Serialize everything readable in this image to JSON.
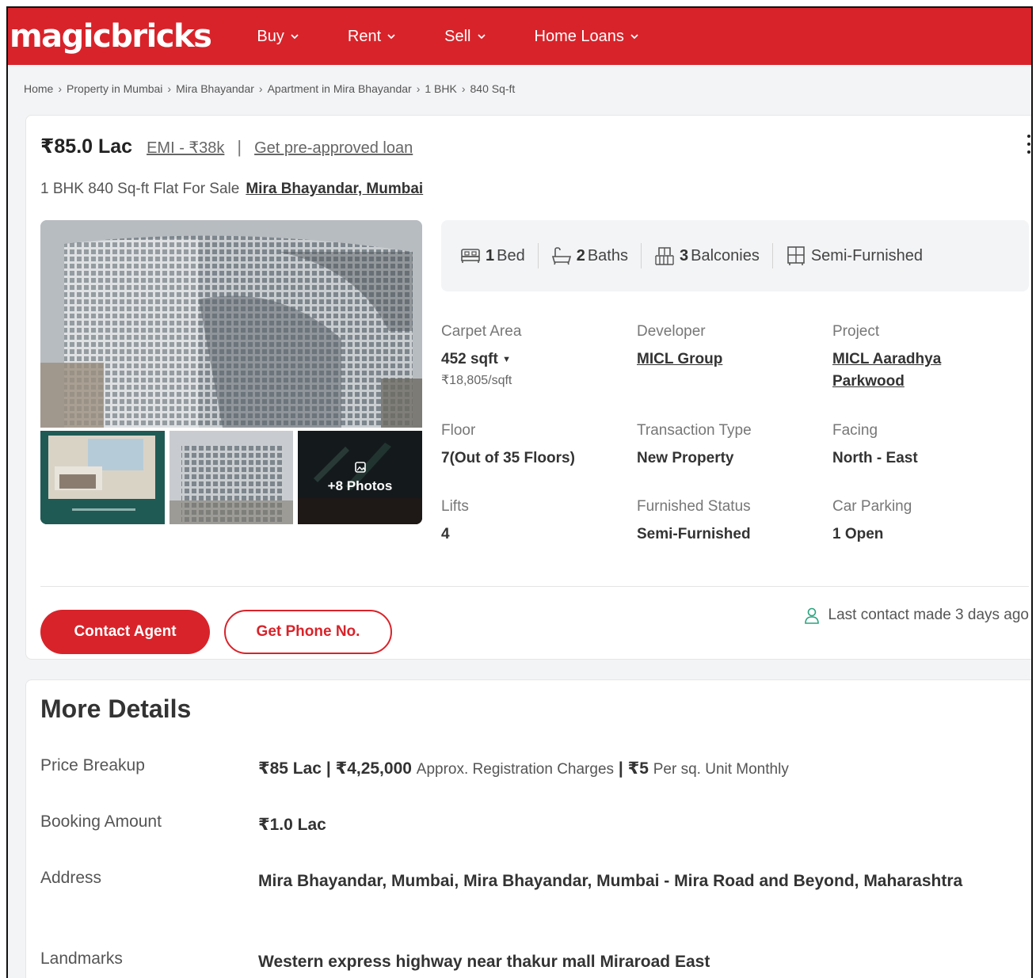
{
  "nav": {
    "logo": "magicbricks",
    "items": [
      {
        "label": "Buy"
      },
      {
        "label": "Rent"
      },
      {
        "label": "Sell"
      },
      {
        "label": "Home Loans"
      }
    ],
    "brand_color": "#d8232a"
  },
  "breadcrumb": [
    "Home",
    "Property in Mumbai",
    "Mira Bhayandar",
    "Apartment in Mira Bhayandar",
    "1 BHK",
    "840 Sq-ft"
  ],
  "listing": {
    "price": "₹85.0 Lac",
    "emi": "EMI - ₹38k",
    "loan_link": "Get pre-approved loan",
    "title": "1 BHK 840 Sq-ft Flat For Sale",
    "location": "Mira Bhayandar, Mumbai",
    "photos_more": "+8 Photos",
    "features": [
      {
        "icon": "bed-icon",
        "count": "1",
        "label": "Bed"
      },
      {
        "icon": "bath-icon",
        "count": "2",
        "label": "Baths"
      },
      {
        "icon": "balcony-icon",
        "count": "3",
        "label": "Balconies"
      },
      {
        "icon": "furniture-icon",
        "count": "",
        "label": "Semi-Furnished"
      }
    ],
    "attributes": {
      "carpet_area": {
        "label": "Carpet Area",
        "value": "452 sqft",
        "sub": "₹18,805/sqft"
      },
      "developer": {
        "label": "Developer",
        "value": "MICL Group"
      },
      "project": {
        "label": "Project",
        "value": "MICL Aaradhya Parkwood"
      },
      "floor": {
        "label": "Floor",
        "value": "7(Out of 35 Floors)"
      },
      "transaction": {
        "label": "Transaction Type",
        "value": "New Property"
      },
      "facing": {
        "label": "Facing",
        "value": "North - East"
      },
      "lifts": {
        "label": "Lifts",
        "value": "4"
      },
      "furnished": {
        "label": "Furnished Status",
        "value": "Semi-Furnished"
      },
      "parking": {
        "label": "Car Parking",
        "value": "1 Open"
      }
    },
    "buttons": {
      "contact": "Contact Agent",
      "phone": "Get Phone No."
    },
    "last_contact": "Last contact made 3 days ago"
  },
  "more_details": {
    "heading": "More Details",
    "price_breakup": {
      "label": "Price Breakup",
      "price": "₹85 Lac",
      "registration": "₹4,25,000",
      "registration_note": "Approx. Registration Charges",
      "maintenance": "₹5",
      "maintenance_note": "Per sq. Unit Monthly"
    },
    "booking": {
      "label": "Booking Amount",
      "value": "₹1.0 Lac"
    },
    "address": {
      "label": "Address",
      "value": "Mira Bhayandar, Mumbai, Mira Bhayandar, Mumbai - Mira Road and Beyond, Maharashtra"
    },
    "landmarks": {
      "label": "Landmarks",
      "value": "Western express highway near thakur mall Miraroad East"
    }
  }
}
